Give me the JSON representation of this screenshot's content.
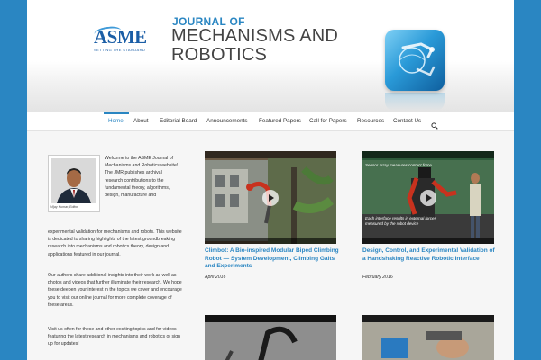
{
  "header": {
    "logo_text": "ASME",
    "logo_tagline": "SETTING THE STANDARD",
    "journal_prefix": "JOURNAL OF",
    "journal_title": "MECHANISMS AND ROBOTICS"
  },
  "nav": {
    "items": [
      {
        "label": "Home",
        "active": true
      },
      {
        "label": "About"
      },
      {
        "label": "Editorial Board"
      },
      {
        "label": "Announcements"
      },
      {
        "label": "Featured Papers"
      },
      {
        "label": "Call for Papers"
      },
      {
        "label": "Resources"
      },
      {
        "label": "Contact Us"
      }
    ],
    "search_icon": "search-icon"
  },
  "sidebar": {
    "portrait_caption": "Vijay Kumar, Editor",
    "welcome": "Welcome to the ASME Journal of Mechanisms and Robotics website! The JMR publishes archival research contributions to the fundamental theory, algorithms, design, manufacture and",
    "welcome_cont": "experimental validation for mechanisms and robots. This website is dedicated to sharing highlights of the latest groundbreaking research into mechanisms and robotics theory, design and applications featured in our journal.",
    "para2": "Our authors share additional insights into their work as well as photos and videos that further illuminate their research. We hope these deepen your interest in the topics we cover and encourage you to visit our online journal for more complete coverage of these areas.",
    "para3": "Visit us often for these and other exciting topics and for videos featuring the latest research in mechanisms and robotics or sign up for updates!"
  },
  "cards": [
    {
      "title": "Climbot: A Bio-inspired Modular Biped Climbing Robot — System Development, Climbing Gaits and Experiments",
      "date": "April 2016"
    },
    {
      "title": "Design, Control, and Experimental Validation of a Handshaking Reactive Robotic Interface",
      "date": "February 2016",
      "video_caption_top": "Sensor array measures contact force",
      "video_caption_bottom": "Each interface results in external forces measured by the robot device"
    }
  ],
  "colors": {
    "accent": "#2a86c2",
    "frame": "#2a86c2"
  }
}
